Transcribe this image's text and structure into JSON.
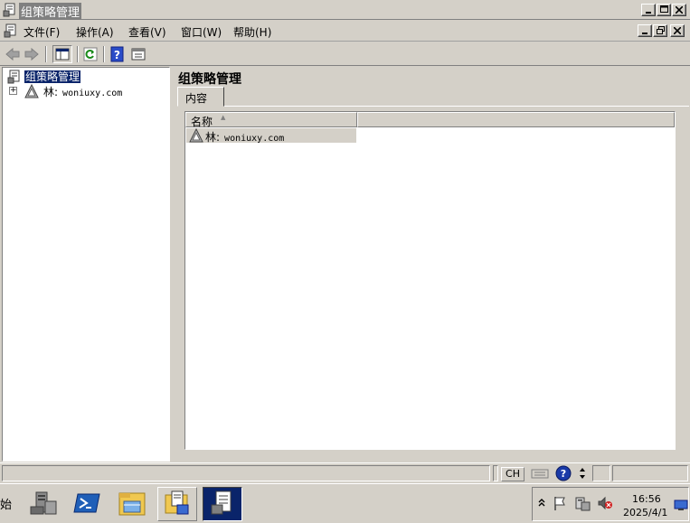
{
  "window": {
    "title": "组策略管理",
    "controls": [
      "minimize-icon",
      "maximize-icon",
      "close-icon"
    ]
  },
  "menu": {
    "items": [
      {
        "label": "文件(F)"
      },
      {
        "label": "操作(A)"
      },
      {
        "label": "查看(V)"
      },
      {
        "label": "窗口(W)"
      },
      {
        "label": "帮助(H)"
      }
    ],
    "mdi_controls": [
      "minimize-icon",
      "restore-icon",
      "close-icon"
    ]
  },
  "toolbar": {
    "icons": [
      "back-arrow-icon",
      "forward-arrow-icon",
      "show-hide-console-tree-icon",
      "refresh-icon",
      "help-icon",
      "properties-icon"
    ]
  },
  "tree": {
    "root": {
      "label": "组策略管理",
      "icon": "group-policy-icon",
      "selected": true
    },
    "children": [
      {
        "prefix": "林:",
        "label": "woniuxy.com",
        "icon": "forest-icon",
        "expander": "+"
      }
    ]
  },
  "right_pane": {
    "title": "组策略管理",
    "tabs": [
      {
        "label": "内容",
        "active": true
      }
    ],
    "columns": [
      {
        "label": "名称",
        "sorted": "ascending"
      }
    ],
    "rows": [
      {
        "prefix": "林:",
        "label": "woniuxy.com",
        "icon": "forest-icon"
      }
    ]
  },
  "statusbar": {
    "ime": "CH",
    "icons": [
      "keyboard-icon",
      "help-circle-icon",
      "ime-options-icon"
    ]
  },
  "taskbar": {
    "start_label": "始",
    "buttons": [
      "server-manager-icon",
      "powershell-icon",
      "explorer-icon",
      "group-policy-folder-icon",
      "group-policy-management-icon"
    ],
    "tray": {
      "icons": [
        "tray-expand-icon",
        "flag-icon",
        "network-icon",
        "volume-muted-icon",
        "show-desktop-icon"
      ],
      "time": "16:56",
      "date": "2025/4/1"
    }
  },
  "colors": {
    "title_bar": "#d4d0c8",
    "selection": "#0a246a",
    "window_bg": "#d4d0c8",
    "pane_bg": "#ffffff"
  }
}
